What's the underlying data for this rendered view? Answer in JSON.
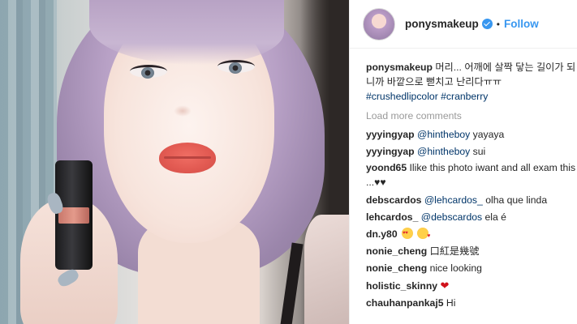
{
  "header": {
    "username": "ponysmakeup",
    "separator": "•",
    "follow_label": "Follow"
  },
  "caption": {
    "user": "ponysmakeup",
    "text": "머리... 어깨에 살짝 닿는 길이가 되니까 바깥으로 뻗치고 난리다ㅠㅠ",
    "tags": [
      "#crushedlipcolor",
      "#cranberry"
    ]
  },
  "load_more_label": "Load more comments",
  "comments": [
    {
      "user": "yyyingyap",
      "mention": "@hintheboy",
      "text": "yayaya"
    },
    {
      "user": "yyyingyap",
      "mention": "@hintheboy",
      "text": "sui"
    },
    {
      "user": "yoond65",
      "mention": "",
      "text": "Ilike this photo iwant and all exam this ...♥♥"
    },
    {
      "user": "debscardos",
      "mention": "@lehcardos_",
      "text": "olha que linda"
    },
    {
      "user": "lehcardos_",
      "mention": "@debscardos",
      "text": "ela é"
    },
    {
      "user": "dn.y80",
      "mention": "",
      "text": ""
    },
    {
      "user": "nonie_cheng",
      "mention": "",
      "text": "口紅是幾號"
    },
    {
      "user": "nonie_cheng",
      "mention": "",
      "text": "nice looking"
    },
    {
      "user": "holistic_skinny",
      "mention": "",
      "text": ""
    },
    {
      "user": "chauhanpankaj5",
      "mention": "",
      "text": "Hi"
    }
  ],
  "emoji": {
    "dny80": [
      "heart-eyes-emoji",
      "kissing-heart-emoji"
    ],
    "holistic": [
      "red-heart-emoji"
    ]
  },
  "colors": {
    "link": "#003569",
    "follow": "#3897f0",
    "verified": "#3897f0",
    "muted": "#999999"
  }
}
